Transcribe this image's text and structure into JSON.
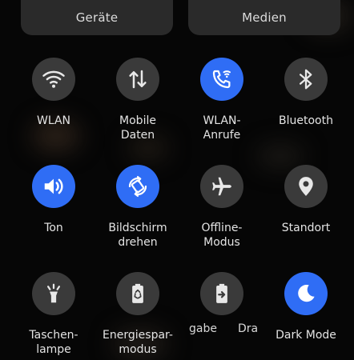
{
  "top_buttons": {
    "devices": "Geräte",
    "media": "Medien"
  },
  "tiles": [
    {
      "line1": "WLAN",
      "line2": "",
      "icon": "wifi-icon",
      "active": false
    },
    {
      "line1": "Mobile",
      "line2": "Daten",
      "icon": "mobile-data-icon",
      "active": false
    },
    {
      "line1": "WLAN-",
      "line2": "Anrufe",
      "icon": "wifi-calling-icon",
      "active": true
    },
    {
      "line1": "Bluetooth",
      "line2": "",
      "icon": "bluetooth-icon",
      "active": false
    },
    {
      "line1": "Ton",
      "line2": "",
      "icon": "volume-icon",
      "active": true
    },
    {
      "line1": "Bildschirm",
      "line2": "drehen",
      "icon": "auto-rotate-icon",
      "active": true
    },
    {
      "line1": "Offline-",
      "line2": "Modus",
      "icon": "airplane-icon",
      "active": false
    },
    {
      "line1": "Standort",
      "line2": "",
      "icon": "location-icon",
      "active": false
    },
    {
      "line1": "Taschen-",
      "line2": "lampe",
      "icon": "flashlight-icon",
      "active": false
    },
    {
      "line1": "Energiespar-",
      "line2": "modus",
      "icon": "battery-saver-icon",
      "active": false
    },
    {
      "line1": "",
      "line2": "",
      "icon": "battery-share-icon",
      "active": false
    },
    {
      "line1": "Dark Mode",
      "line2": "",
      "icon": "dark-mode-icon",
      "active": true
    }
  ],
  "partial_labels": {
    "left": "gabe",
    "right": "Dra"
  },
  "colors": {
    "active": "#2f6df5",
    "inactive": "#3a3a3a",
    "background": "#060606"
  }
}
